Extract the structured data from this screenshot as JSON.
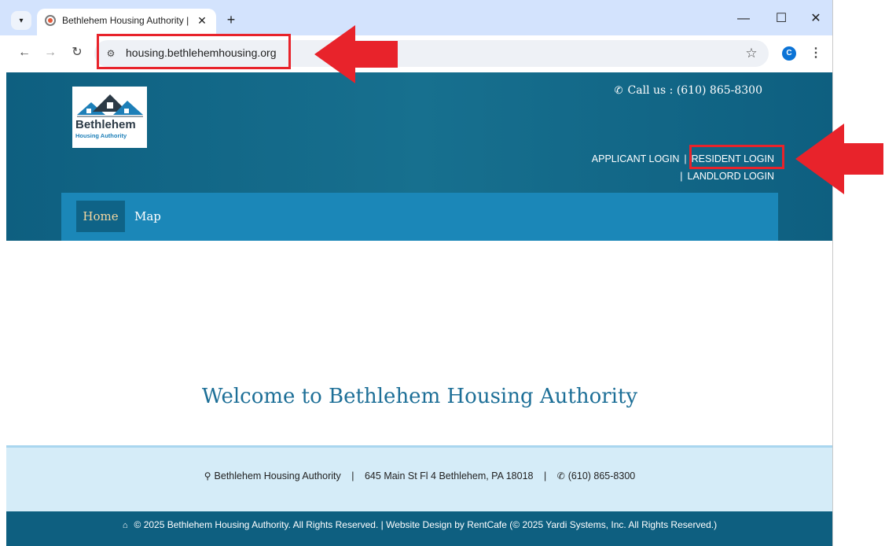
{
  "browser": {
    "tab_title": "Bethlehem Housing Authority |",
    "tab_close": "✕",
    "new_tab": "+",
    "url": "housing.bethlehemhousing.org",
    "profile_initial": "C",
    "window_minimize": "—",
    "window_maximize": "☐",
    "window_close": "✕"
  },
  "header": {
    "logo_name": "Bethlehem",
    "logo_sub": "Housing Authority",
    "call_us": "Call us : (610) 865-8300",
    "applicant_login": "APPLICANT LOGIN",
    "resident_login": "RESIDENT LOGIN",
    "landlord_login": "LANDLORD LOGIN",
    "separator": "|"
  },
  "nav": {
    "home": "Home",
    "map": "Map"
  },
  "main": {
    "welcome": "Welcome to Bethlehem Housing Authority"
  },
  "footer": {
    "org_name": "Bethlehem Housing Authority",
    "address": "645 Main St Fl 4  Bethlehem, PA 18018",
    "phone": "(610) 865-8300",
    "separator": "|",
    "copyright": "© 2025 Bethlehem Housing Authority. All Rights Reserved. | Website Design by RentCafe (© 2025 Yardi Systems, Inc. All Rights Reserved.)"
  },
  "colors": {
    "header_bg": "#17708f",
    "nav_bg": "#1b87b8",
    "welcome_text": "#1d6f97",
    "footer_info_bg": "#d5ecf8",
    "annotation_red": "#e8232b"
  },
  "icons": [
    "tab-search-icon",
    "site-favicon",
    "back-icon",
    "forward-icon",
    "reload-icon",
    "site-info-icon",
    "star-icon",
    "kebab-icon",
    "phone-icon",
    "pin-icon",
    "home-icon"
  ]
}
